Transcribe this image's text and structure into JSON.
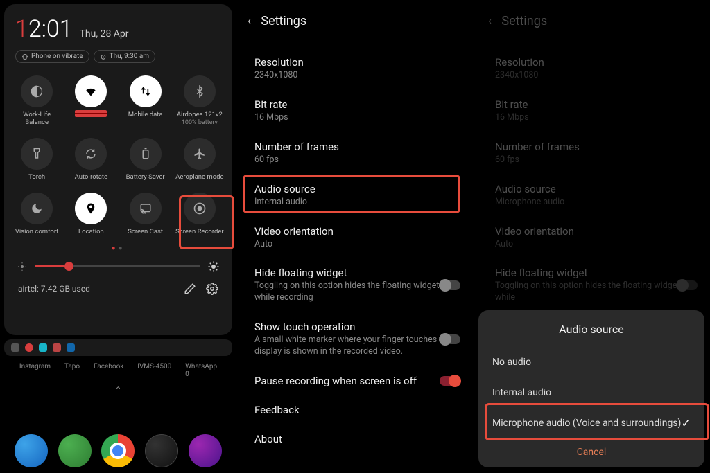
{
  "panel1": {
    "clock_hour1": "1",
    "clock_rest": "2:01",
    "date": "Thu, 28 Apr",
    "chip_vibrate": "Phone on vibrate",
    "chip_alarm": "Thu, 9:30 am",
    "tiles": [
      {
        "label": "Work-Life Balance",
        "on": false,
        "icon": "half-moon"
      },
      {
        "label": "redacted",
        "on": true,
        "icon": "wifi"
      },
      {
        "label": "Mobile data",
        "on": true,
        "icon": "data-arrows"
      },
      {
        "label": "Airdopes 121v2",
        "sub": "100% battery",
        "on": false,
        "icon": "bluetooth"
      },
      {
        "label": "Torch",
        "on": false,
        "icon": "flashlight"
      },
      {
        "label": "Auto-rotate",
        "on": false,
        "icon": "rotate"
      },
      {
        "label": "Battery Saver",
        "on": false,
        "icon": "battery"
      },
      {
        "label": "Aeroplane mode",
        "on": false,
        "icon": "plane"
      },
      {
        "label": "Vision comfort",
        "on": false,
        "icon": "moon"
      },
      {
        "label": "Location",
        "on": true,
        "icon": "pin"
      },
      {
        "label": "Screen Cast",
        "on": false,
        "icon": "cast"
      },
      {
        "label": "Screen Recorder",
        "on": false,
        "icon": "record"
      }
    ],
    "data_used": "airtel: 7.42 GB used",
    "apps": [
      "Instagram",
      "Tapo",
      "Facebook",
      "IVMS-4500",
      "WhatsApp"
    ],
    "app_counts": [
      "",
      "",
      "",
      "",
      "0"
    ]
  },
  "panel2": {
    "header": "Settings",
    "items": [
      {
        "title": "Resolution",
        "sub": "2340x1080"
      },
      {
        "title": "Bit rate",
        "sub": "16 Mbps"
      },
      {
        "title": "Number of frames",
        "sub": "60 fps"
      },
      {
        "title": "Audio source",
        "sub": "Internal audio"
      },
      {
        "title": "Video orientation",
        "sub": "Auto"
      },
      {
        "title": "Hide floating widget",
        "sub": "Toggling on this option hides the floating widget while recording",
        "toggle": "off"
      },
      {
        "title": "Show touch operation",
        "sub": "A small white marker where your finger touches the display is shown in the recorded video.",
        "toggle": "off"
      },
      {
        "title": "Pause recording when screen is off",
        "toggle": "on"
      },
      {
        "title": "Feedback"
      },
      {
        "title": "About"
      }
    ]
  },
  "panel3": {
    "header": "Settings",
    "items": [
      {
        "title": "Resolution",
        "sub": "2340x1080"
      },
      {
        "title": "Bit rate",
        "sub": "16 Mbps"
      },
      {
        "title": "Number of frames",
        "sub": "60 fps"
      },
      {
        "title": "Audio source",
        "sub": "Microphone audio"
      },
      {
        "title": "Video orientation",
        "sub": "Auto"
      },
      {
        "title": "Hide floating widget",
        "sub": "Toggling on this option hides the floating widget while",
        "toggle": "off"
      }
    ],
    "dialog": {
      "title": "Audio source",
      "options": [
        "No audio",
        "Internal audio",
        "Microphone audio (Voice and surroundings)"
      ],
      "selected": 2,
      "cancel": "Cancel"
    }
  }
}
